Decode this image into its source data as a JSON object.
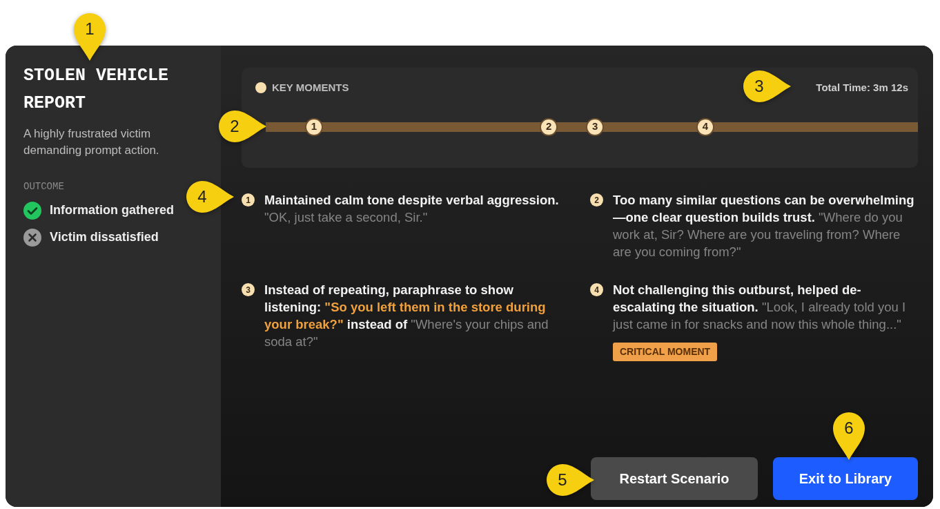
{
  "scenario": {
    "title": "STOLEN VEHICLE REPORT",
    "description": "A highly frustrated victim demanding prompt action."
  },
  "outcome": {
    "heading": "OUTCOME",
    "items": [
      {
        "label": "Information gathered",
        "kind": "success"
      },
      {
        "label": "Victim dissatisfied",
        "kind": "fail"
      }
    ]
  },
  "timeline": {
    "heading": "KEY MOMENTS",
    "total_time": "Total Time: 3m 12s",
    "markers": [
      {
        "label": "1",
        "level": 0.074
      },
      {
        "label": "2",
        "level": 0.434
      },
      {
        "label": "3",
        "level": 0.505
      },
      {
        "label": "4",
        "level": 0.674
      }
    ]
  },
  "moments": [
    {
      "number": "1",
      "segments": [
        {
          "kind": "bold",
          "text": "Maintained calm tone despite verbal aggression."
        },
        {
          "kind": "quote",
          "text": "\"OK, just take a second, Sir.\""
        }
      ]
    },
    {
      "number": "2",
      "segments": [
        {
          "kind": "bold",
          "text": "Too many similar questions can be overwhelming—one clear question builds trust."
        },
        {
          "kind": "quote",
          "text": "\"Where do you work at, Sir? Where are you traveling from? Where are you coming from?\""
        }
      ]
    },
    {
      "number": "3",
      "segments": [
        {
          "kind": "bold",
          "text": "Instead of repeating, paraphrase to show listening:"
        },
        {
          "kind": "highlight",
          "text": "\"So you left them in the store during your break?\""
        },
        {
          "kind": "bold",
          "text": "instead of"
        },
        {
          "kind": "quote",
          "text": "\"Where's your chips and soda at?\""
        }
      ]
    },
    {
      "number": "4",
      "badge": "CRITICAL MOMENT",
      "segments": [
        {
          "kind": "bold",
          "text": "Not challenging this outburst, helped de-escalating the situation."
        },
        {
          "kind": "quote",
          "text": "\"Look, I already told you I just came in for snacks and now this whole thing...\""
        }
      ]
    }
  ],
  "buttons": [
    {
      "label": "Restart Scenario",
      "kind": "secondary"
    },
    {
      "label": "Exit to Library",
      "kind": "primary"
    }
  ],
  "callouts": [
    {
      "label": "1",
      "kind": "down"
    },
    {
      "label": "2",
      "kind": "right"
    },
    {
      "label": "3",
      "kind": "right"
    },
    {
      "label": "4",
      "kind": "right"
    },
    {
      "label": "5",
      "kind": "right"
    },
    {
      "label": "6",
      "kind": "down"
    }
  ]
}
